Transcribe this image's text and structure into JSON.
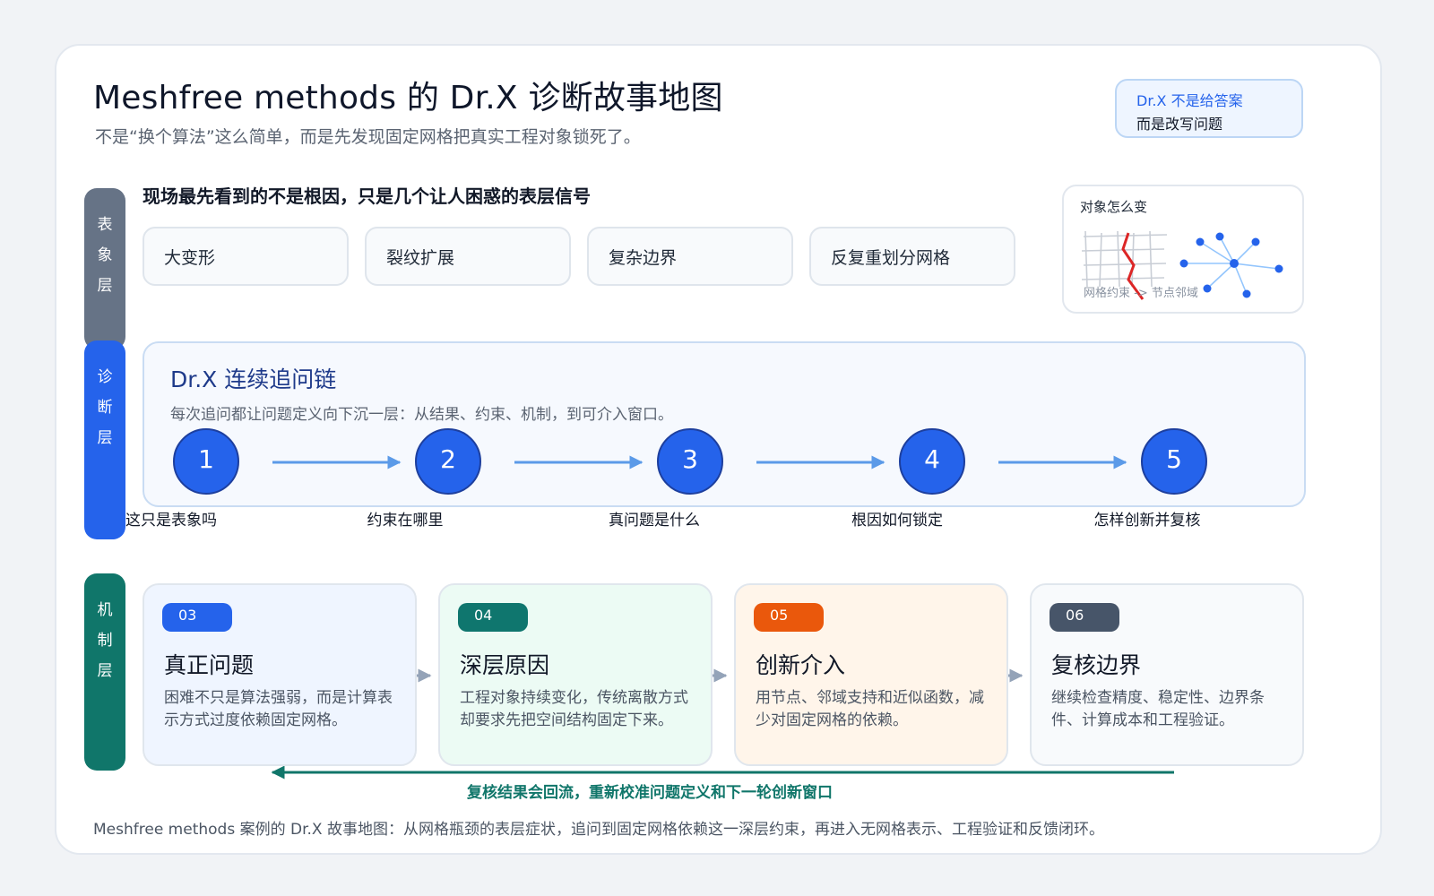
{
  "header": {
    "title": "Meshfree methods 的 Dr.X 诊断故事地图",
    "subtitle": "不是“换个算法”这么简单，而是先发现固定网格把真实工程对象锁死了。"
  },
  "note": {
    "line1": "Dr.X 不是给答案",
    "line2": "而是改写问题"
  },
  "layers": {
    "surface": [
      "表",
      "象",
      "层"
    ],
    "diagnosis": [
      "诊",
      "断",
      "层"
    ],
    "mechanism": [
      "机",
      "制",
      "层"
    ]
  },
  "surface": {
    "label": "现场最先看到的不是根因，只是几个让人困惑的表层信号",
    "signals": [
      "大变形",
      "裂纹扩展",
      "复杂边界",
      "反复重划分网格"
    ]
  },
  "object_panel": {
    "title": "对象怎么变",
    "caption": "网格约束 -> 节点邻域"
  },
  "diagnosis": {
    "title": "Dr.X 连续追问链",
    "subtitle": "每次追问都让问题定义向下沉一层：从结果、约束、机制，到可介入窗口。",
    "steps": [
      {
        "num": "1",
        "label": "这只是表象吗"
      },
      {
        "num": "2",
        "label": "约束在哪里"
      },
      {
        "num": "3",
        "label": "真问题是什么"
      },
      {
        "num": "4",
        "label": "根因如何锁定"
      },
      {
        "num": "5",
        "label": "怎样创新并复核"
      }
    ]
  },
  "mechanism": {
    "cards": [
      {
        "badge": "03",
        "title": "真正问题",
        "text": "困难不只是算法强弱，而是计算表示方式过度依赖固定网格。",
        "badge_color": "#2563eb",
        "bg": "#eff5ff"
      },
      {
        "badge": "04",
        "title": "深层原因",
        "text": "工程对象持续变化，传统离散方式却要求先把空间结构固定下来。",
        "badge_color": "#0f766e",
        "bg": "#ecfbf4"
      },
      {
        "badge": "05",
        "title": "创新介入",
        "text": "用节点、邻域支持和近似函数，减少对固定网格的依赖。",
        "badge_color": "#ea580c",
        "bg": "#fff5ea"
      },
      {
        "badge": "06",
        "title": "复核边界",
        "text": "继续检查精度、稳定性、边界条件、计算成本和工程验证。",
        "badge_color": "#475569",
        "bg": "#f8fafc"
      }
    ],
    "loop_label": "复核结果会回流，重新校准问题定义和下一轮创新窗口"
  },
  "footer": "Meshfree methods 案例的 Dr.X 故事地图：从网格瓶颈的表层症状，追问到固定网格依赖这一深层约束，再进入无网格表示、工程验证和反馈闭环。",
  "colors": {
    "accent_blue": "#2563eb",
    "teal": "#10766a",
    "orange": "#ea580c",
    "slate": "#475569",
    "gray_bar": "#667386"
  }
}
